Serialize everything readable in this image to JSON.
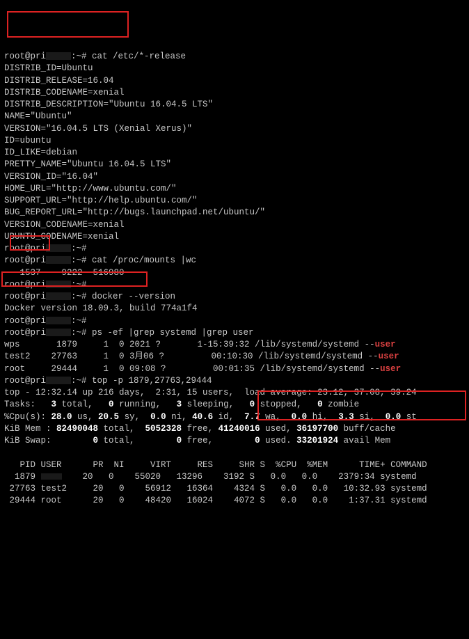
{
  "prompt": {
    "userhost": "root@pri",
    "tilde": ":~#"
  },
  "cmds": {
    "cat_release": "cat /etc/*-release",
    "wc": "cat /proc/mounts |wc",
    "docker": "docker --version",
    "ps": "ps -ef |grep systemd |grep user",
    "top": "top -p 1879,27763,29444"
  },
  "release": {
    "DISTRIB_ID": "Ubuntu",
    "DISTRIB_RELEASE": "16.04",
    "DISTRIB_CODENAME": "xenial",
    "DISTRIB_DESCRIPTION": "\"Ubuntu 16.04.5 LTS\"",
    "NAME": "\"Ubuntu\"",
    "VERSION": "\"16.04.5 LTS (Xenial Xerus)\"",
    "ID": "ubuntu",
    "ID_LIKE": "debian",
    "PRETTY_NAME": "\"Ubuntu 16.04.5 LTS\"",
    "VERSION_ID": "\"16.04\"",
    "HOME_URL": "\"http://www.ubuntu.com/\"",
    "SUPPORT_URL": "\"http://help.ubuntu.com/\"",
    "BUG_REPORT_URL": "\"http://bugs.launchpad.net/ubuntu/\"",
    "VERSION_CODENAME": "xenial",
    "UBUNTU_CODENAME": "xenial"
  },
  "wc_out": {
    "lines": "1537",
    "words": "9222",
    "bytes": "516980"
  },
  "docker_out": "Docker version 18.09.3, build 774a1f4",
  "ps_rows": [
    {
      "user": "wps",
      "pid": "1879",
      "c1": "1",
      "c2": "0 2021 ?",
      "time": "1-15:39:32",
      "cmd": "/lib/systemd/systemd --",
      "suffix": "user"
    },
    {
      "user": "test2",
      "pid": "27763",
      "c1": "1",
      "c2": "0 3月06 ?",
      "time": "00:10:30",
      "cmd": "/lib/systemd/systemd --",
      "suffix": "user"
    },
    {
      "user": "root",
      "pid": "29444",
      "c1": "1",
      "c2": "0 09:08 ?",
      "time": "00:01:35",
      "cmd": "/lib/systemd/systemd --",
      "suffix": "user"
    }
  ],
  "top_header": {
    "line1": "top - 12:32.14 up 216 days,  2:31, 15 users,  load average: 23.12, 37.08, 39.24",
    "line2_a": "Tasks:   ",
    "t_total": "3",
    "t_run": "0",
    "t_sleep": "3",
    "t_stop": "0",
    "t_zom": "0",
    "line3": "%Cpu(s): 28.0 us, 20.5 sy,  0.0 ni, 40.6 id,  7.7 wa,  0.0 hi,  3.3 si,  0.0 st",
    "mem_total": "82490048",
    "mem_free": "5052328",
    "mem_used": "41240016",
    "mem_cache": "36197700",
    "swap_total": "0",
    "swap_free": "0",
    "swap_used": "0",
    "swap_avail": "33201924"
  },
  "top_cols": {
    "pid": "PID",
    "user": "USER",
    "pr": "PR",
    "ni": "NI",
    "virt": "VIRT",
    "res": "RES",
    "shr": "SHR",
    "s": "S",
    "cpu": "%CPU",
    "mem": "%MEM",
    "time": "TIME+",
    "cmd": "COMMAND"
  },
  "top_rows": [
    {
      "pid": "1879",
      "user": "",
      "pr": "20",
      "ni": "0",
      "virt": "55020",
      "res": "13296",
      "shr": "3192",
      "s": "S",
      "cpu": "0.0",
      "mem": "0.0",
      "time": "2379:34",
      "cmd": "systemd"
    },
    {
      "pid": "27763",
      "user": "test2",
      "pr": "20",
      "ni": "0",
      "virt": "56912",
      "res": "16364",
      "shr": "4324",
      "s": "S",
      "cpu": "0.0",
      "mem": "0.0",
      "time": "10:32.93",
      "cmd": "systemd"
    },
    {
      "pid": "29444",
      "user": "root",
      "pr": "20",
      "ni": "0",
      "virt": "48420",
      "res": "16024",
      "shr": "4072",
      "s": "S",
      "cpu": "0.0",
      "mem": "0.0",
      "time": "1:37.31",
      "cmd": "systemd"
    }
  ]
}
